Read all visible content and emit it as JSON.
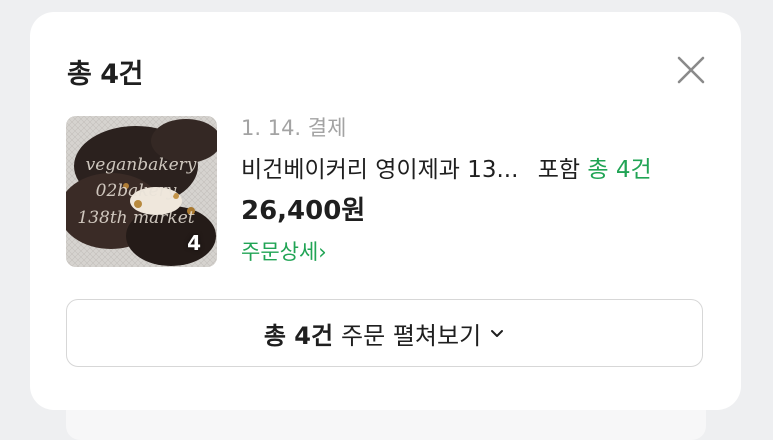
{
  "sheet": {
    "title": "총 4건",
    "close_icon": "close-icon"
  },
  "order": {
    "thumbnail_count": "4",
    "thumbnail_watermark": [
      "veganbakery",
      "02bakery",
      "138th market"
    ],
    "date": "1. 14. 결제",
    "product_name": "비건베이커리 영이제과 13...",
    "product_suffix": "포함",
    "product_total": "총 4건",
    "price": "26,400원",
    "detail_link": "주문상세",
    "detail_chevron": "›"
  },
  "expand_button": {
    "bold": "총 4건",
    "rest": "주문 펼쳐보기",
    "icon": "chevron-down-icon"
  },
  "colors": {
    "accent_green": "#21a455",
    "muted_gray": "#a3a3a3"
  }
}
